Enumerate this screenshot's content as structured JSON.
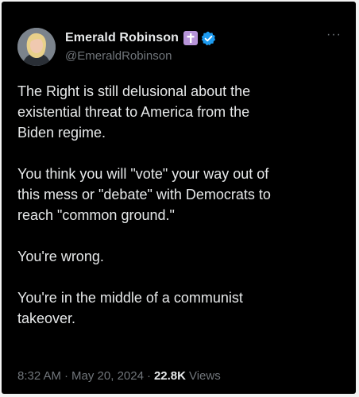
{
  "tweet": {
    "author_name": "Emerald Robinson",
    "handle": "@EmeraldRobinson",
    "more_icon": "more-horizontal-icon",
    "badges": [
      "cross-badge-icon",
      "verified-badge-icon"
    ],
    "paragraphs": [
      "The Right is still delusional about the\nexistential threat to America from the\nBiden regime.",
      "You think you will \"vote\" your way out of\nthis mess or \"debate\" with Democrats to\nreach \"common ground.\"",
      "You're wrong.",
      "You're in the middle of a communist\ntakeover."
    ],
    "time": "8:32 AM",
    "separator": "·",
    "date": "May 20, 2024",
    "views_count": "22.8K",
    "views_label": "Views"
  },
  "colors": {
    "background": "#000000",
    "text": "#e7e9ea",
    "muted": "#71767b",
    "verified": "#1d9bf0",
    "cross_badge": "#b794d9"
  }
}
